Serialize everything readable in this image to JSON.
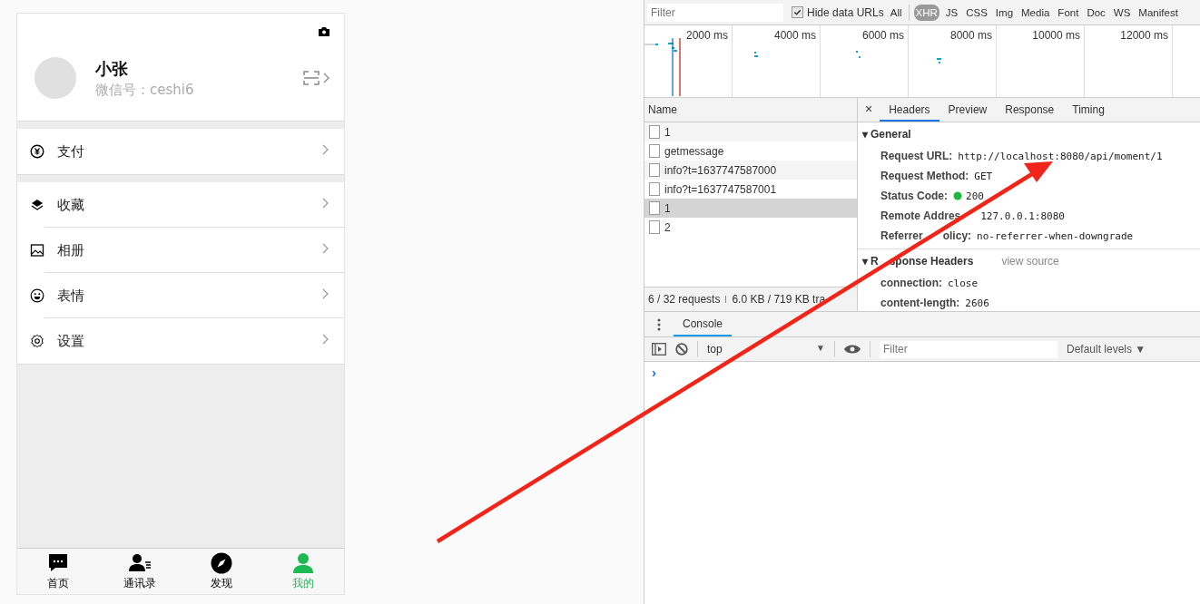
{
  "phone": {
    "profile": {
      "name": "小张",
      "wechat_id": "微信号：ceshi6"
    },
    "menu_groups": [
      [
        {
          "kind": "pay",
          "label": "支付"
        }
      ],
      [
        {
          "kind": "layers",
          "label": "收藏"
        },
        {
          "kind": "image",
          "label": "相册"
        },
        {
          "kind": "smile",
          "label": "表情"
        },
        {
          "kind": "gear",
          "label": "设置"
        }
      ]
    ],
    "tabbar": [
      {
        "kind": "chat",
        "label": "首页",
        "selected": false
      },
      {
        "kind": "contacts",
        "label": "通讯录",
        "selected": false
      },
      {
        "kind": "compass",
        "label": "发现",
        "selected": false
      },
      {
        "kind": "person",
        "label": "我的",
        "selected": true
      }
    ]
  },
  "devtools": {
    "filter_bar": {
      "placeholder": "Filter",
      "hide_data_urls": {
        "label": "Hide data URLs",
        "checked": true
      },
      "types": [
        {
          "label": "All",
          "selected": false
        },
        {
          "label": "XHR",
          "selected": true
        },
        {
          "label": "JS",
          "selected": false
        },
        {
          "label": "CSS",
          "selected": false
        },
        {
          "label": "Img",
          "selected": false
        },
        {
          "label": "Media",
          "selected": false
        },
        {
          "label": "Font",
          "selected": false
        },
        {
          "label": "Doc",
          "selected": false
        },
        {
          "label": "WS",
          "selected": false
        },
        {
          "label": "Manifest",
          "selected": false
        }
      ]
    },
    "timeline_ticks": [
      "2000 ms",
      "4000 ms",
      "6000 ms",
      "8000 ms",
      "10000 ms",
      "12000 ms"
    ],
    "requests": {
      "header": "Name",
      "rows": [
        {
          "name": "1",
          "selected": false
        },
        {
          "name": "getmessage",
          "selected": false
        },
        {
          "name": "info?t=1637747587000",
          "selected": false
        },
        {
          "name": "info?t=1637747587001",
          "selected": false
        },
        {
          "name": "1",
          "selected": true
        },
        {
          "name": "2",
          "selected": false
        }
      ],
      "summary": "6 / 32 requests",
      "transfer": "6.0 KB / 719 KB tra"
    },
    "details": {
      "close": "×",
      "tabs": [
        {
          "label": "Headers",
          "selected": true
        },
        {
          "label": "Preview",
          "selected": false
        },
        {
          "label": "Response",
          "selected": false
        },
        {
          "label": "Timing",
          "selected": false
        }
      ],
      "sections": [
        {
          "toggle": "▾",
          "title": [
            "General"
          ],
          "rows": [
            {
              "key": [
                "Request URL:"
              ],
              "value": "http://localhost:8080/api/moment/1",
              "kind": "text"
            },
            {
              "key": [
                "Request Method:"
              ],
              "value": "GET",
              "kind": "text"
            },
            {
              "key": [
                "Status Code:"
              ],
              "value": "200",
              "kind": "status"
            },
            {
              "key": [
                "Remote Addres"
              ],
              "value": "127.0.0.1:8080",
              "kind": "covered"
            },
            {
              "key": [
                "Referrer",
                "olicy:"
              ],
              "value": "no-referrer-when-downgrade",
              "kind": "text"
            }
          ]
        },
        {
          "toggle": "▾",
          "title": [
            "R",
            "sponse Headers"
          ],
          "link": "view source",
          "rows": [
            {
              "key": [
                "connection:"
              ],
              "value": "close",
              "kind": "text"
            },
            {
              "key": [
                "content-length:"
              ],
              "value": "2606",
              "kind": "text"
            }
          ]
        }
      ]
    },
    "drawer": {
      "tab": "Console",
      "context": "top",
      "context_caret": "▼",
      "filter_placeholder": "Filter",
      "levels": "Default levels ▼",
      "prompt": "›"
    }
  }
}
